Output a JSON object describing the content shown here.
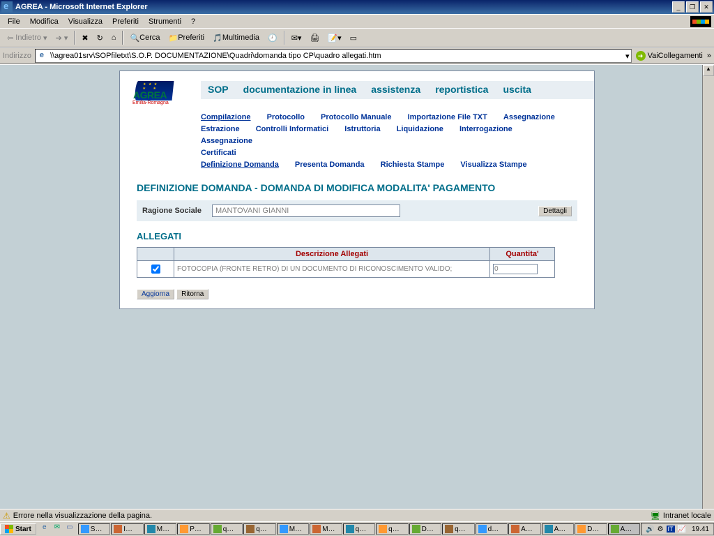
{
  "window": {
    "title": "AGREA - Microsoft Internet Explorer"
  },
  "menubar": [
    "File",
    "Modifica",
    "Visualizza",
    "Preferiti",
    "Strumenti",
    "?"
  ],
  "toolbar": {
    "back": "Indietro",
    "search": "Cerca",
    "favorites": "Preferiti",
    "multimedia": "Multimedia"
  },
  "addressbar": {
    "label": "Indirizzo",
    "url": "\\\\agrea01srv\\SOPfiletxt\\S.O.P. DOCUMENTAZIONE\\Quadri\\domanda tipo CP\\quadro allegati.htm",
    "go": "Vai",
    "links": "Collegamenti"
  },
  "logo": {
    "main": "AGREA",
    "sub": "Emilia-Romagna"
  },
  "topnav": [
    "SOP",
    "documentazione in linea",
    "assistenza",
    "reportistica",
    "uscita"
  ],
  "navrow1": [
    "Compilazione",
    "Protocollo",
    "Protocollo Manuale",
    "Importazione File TXT",
    "Assegnazione"
  ],
  "navrow2": [
    "Estrazione",
    "Controlli Informatici",
    "Istruttoria",
    "Liquidazione",
    "Interrogazione",
    "Assegnazione"
  ],
  "navrow3": [
    "Certificati"
  ],
  "navrow4": [
    "Definizione Domanda",
    "Presenta Domanda",
    "Richiesta Stampe",
    "Visualizza Stampe"
  ],
  "page_title": "DEFINIZIONE DOMANDA -  DOMANDA DI MODIFICA MODALITA' PAGAMENTO",
  "ragione": {
    "label": "Ragione Sociale",
    "value": "MANTOVANI GIANNI",
    "button": "Dettagli"
  },
  "section_title": "ALLEGATI",
  "table": {
    "headers": {
      "desc": "Descrizione Allegati",
      "qty": "Quantita'"
    },
    "row": {
      "checked": true,
      "desc": "FOTOCOPIA (FRONTE RETRO) DI UN DOCUMENTO DI RICONOSCIMENTO VALIDO;",
      "qty": "0"
    }
  },
  "buttons": {
    "aggiorna": "Aggiorna",
    "ritorna": "Ritorna"
  },
  "statusbar": {
    "warning": "Errore nella visualizzazione della pagina.",
    "zone": "Intranet locale"
  },
  "taskbar": {
    "start": "Start",
    "tasks": [
      "S…",
      "I…",
      "M…",
      "P…",
      "q…",
      "q…",
      "M…",
      "M…",
      "q…",
      "q…",
      "D…",
      "q…",
      "d…",
      "A…",
      "A…",
      "D…",
      "A…"
    ],
    "lang": "IT",
    "clock": "19.41"
  }
}
